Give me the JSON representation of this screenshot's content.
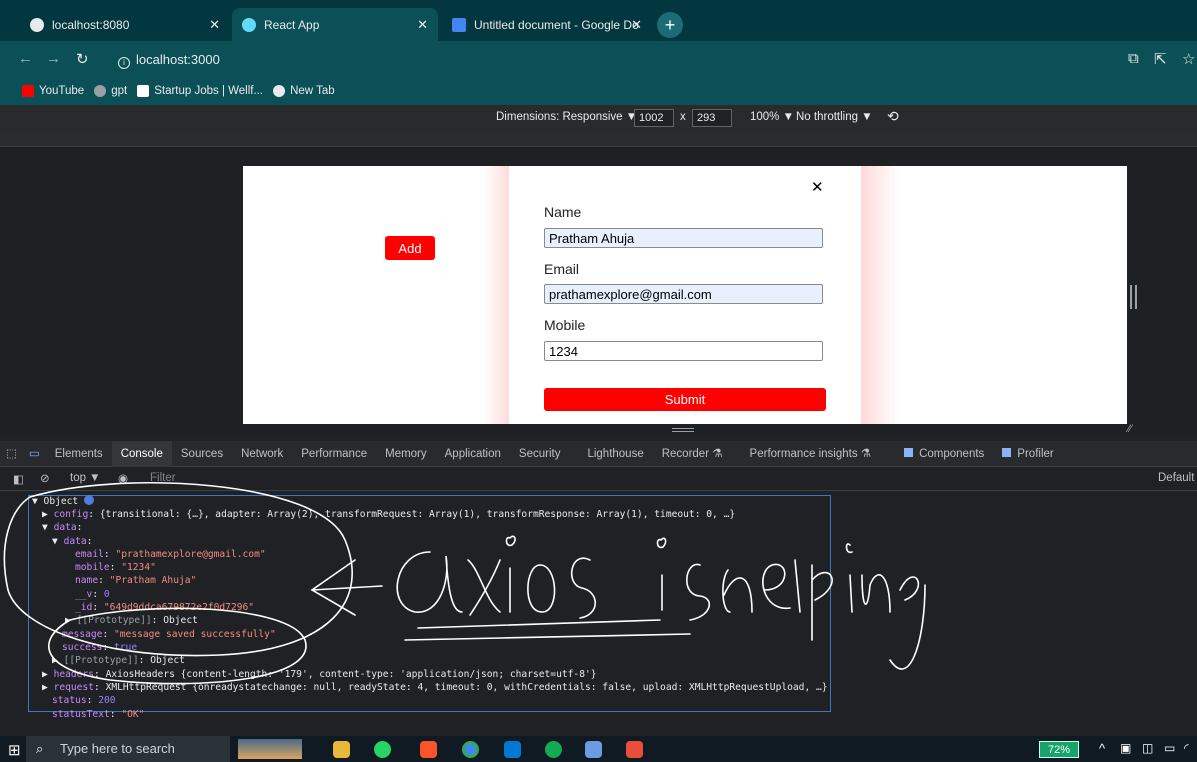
{
  "browser": {
    "tabs": [
      {
        "title": "localhost:8080",
        "close": "✕"
      },
      {
        "title": "React App",
        "close": "✕"
      },
      {
        "title": "Untitled document - Google Do",
        "close": "✕"
      }
    ],
    "new_tab": "+",
    "url": "localhost:3000",
    "bookmarks": [
      "YouTube",
      "gpt",
      "Startup Jobs | Wellf...",
      "New Tab"
    ]
  },
  "device_toolbar": {
    "dimensions_label": "Dimensions: Responsive ▼",
    "width": "1002",
    "times": "x",
    "height": "293",
    "zoom": "100% ▼",
    "throttling": "No throttling ▼"
  },
  "app": {
    "add_label": "Add",
    "close_label": "✕",
    "name_label": "Name",
    "name_value": "Pratham Ahuja",
    "email_label": "Email",
    "email_value": "prathamexplore@gmail.com",
    "mobile_label": "Mobile",
    "mobile_value": "1234",
    "submit_label": "Submit"
  },
  "devtools": {
    "tabs": [
      "Elements",
      "Console",
      "Sources",
      "Network",
      "Performance",
      "Memory",
      "Application",
      "Security",
      "Lighthouse",
      "Recorder ⚗",
      "Performance insights ⚗",
      "Components",
      "Profiler"
    ],
    "context": "top ▼",
    "filter_placeholder": "Filter",
    "levels": "Default"
  },
  "console": {
    "lines": [
      {
        "text": "▼ Object "
      },
      {
        "key": "config",
        "val": " {transitional: {…}, adapter: Array(2), transformRequest: Array(1), transformResponse: Array(1), timeout: 0, …}"
      },
      {
        "key": "data",
        "val": ":"
      },
      {
        "key": "data",
        "val": ":"
      },
      {
        "key": "email",
        "val": "\"prathamexplore@gmail.com\""
      },
      {
        "key": "mobile",
        "val": "\"1234\""
      },
      {
        "key": "name",
        "val": "\"Pratham Ahuja\""
      },
      {
        "key": "__v",
        "val": "0"
      },
      {
        "key": "_id",
        "val": "\"649d9ddca679872e2f0d7296\""
      },
      {
        "key": "[[Prototype]]",
        "val": "Object"
      },
      {
        "key": "message",
        "val": "\"message saved successfully\""
      },
      {
        "key": "success",
        "val": "true"
      },
      {
        "key": "[[Prototype]]",
        "val": "Object"
      },
      {
        "key": "headers",
        "val": "AxiosHeaders {content-length: '179', content-type: 'application/json; charset=utf-8'}"
      },
      {
        "key": "request",
        "val": "XMLHttpRequest {onreadystatechange: null, readyState: 4, timeout: 0, withCredentials: false, upload: XMLHttpRequestUpload, …}"
      },
      {
        "key": "status",
        "val": "200"
      },
      {
        "key": "statusText",
        "val": "\"OK\""
      }
    ]
  },
  "annotation": {
    "text": "axios is helping"
  },
  "taskbar": {
    "search_placeholder": "Type here to search",
    "battery": "72%"
  },
  "colors": {
    "accent": "#ff0000",
    "chrome_teal": "#0b5057"
  }
}
